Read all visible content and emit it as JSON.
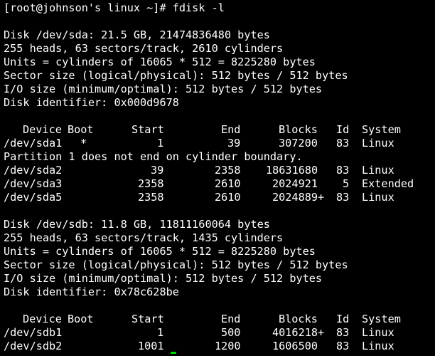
{
  "colors": {
    "background": "#000000",
    "foreground": "#ffffff",
    "cursor": "#00d000"
  },
  "prompt_line": "[root@johnson's linux ~]# fdisk -l",
  "disk_sda": {
    "info": [
      "Disk /dev/sda: 21.5 GB, 21474836480 bytes",
      "255 heads, 63 sectors/track, 2610 cylinders",
      "Units = cylinders of 16065 * 512 = 8225280 bytes",
      "Sector size (logical/physical): 512 bytes / 512 bytes",
      "I/O size (minimum/optimal): 512 bytes / 512 bytes",
      "Disk identifier: 0x000d9678"
    ],
    "header": {
      "device": "Device",
      "boot": "Boot",
      "start": "Start",
      "end": "End",
      "blocks": "Blocks",
      "id": "Id",
      "system": "System"
    },
    "partitions": [
      {
        "device": "/dev/sda1",
        "boot": "*",
        "start": "1",
        "end": "39",
        "blocks": "307200",
        "id": "83",
        "system": "Linux"
      },
      {
        "device": "/dev/sda2",
        "boot": "",
        "start": "39",
        "end": "2358",
        "blocks": "18631680",
        "id": "83",
        "system": "Linux"
      },
      {
        "device": "/dev/sda3",
        "boot": "",
        "start": "2358",
        "end": "2610",
        "blocks": "2024921",
        "id": "5",
        "system": "Extended"
      },
      {
        "device": "/dev/sda5",
        "boot": "",
        "start": "2358",
        "end": "2610",
        "blocks": "2024889+",
        "id": "83",
        "system": "Linux"
      }
    ],
    "warning": "Partition 1 does not end on cylinder boundary."
  },
  "disk_sdb": {
    "info": [
      "Disk /dev/sdb: 11.8 GB, 11811160064 bytes",
      "255 heads, 63 sectors/track, 1435 cylinders",
      "Units = cylinders of 16065 * 512 = 8225280 bytes",
      "Sector size (logical/physical): 512 bytes / 512 bytes",
      "I/O size (minimum/optimal): 512 bytes / 512 bytes",
      "Disk identifier: 0x78c628be"
    ],
    "header": {
      "device": "Device",
      "boot": "Boot",
      "start": "Start",
      "end": "End",
      "blocks": "Blocks",
      "id": "Id",
      "system": "System"
    },
    "partitions": [
      {
        "device": "/dev/sdb1",
        "boot": "",
        "start": "1",
        "end": "500",
        "blocks": "4016218+",
        "id": "83",
        "system": "Linux"
      },
      {
        "device": "/dev/sdb2",
        "boot": "",
        "start": "1001",
        "end": "1200",
        "blocks": "1606500",
        "id": "83",
        "system": "Linux"
      }
    ]
  }
}
